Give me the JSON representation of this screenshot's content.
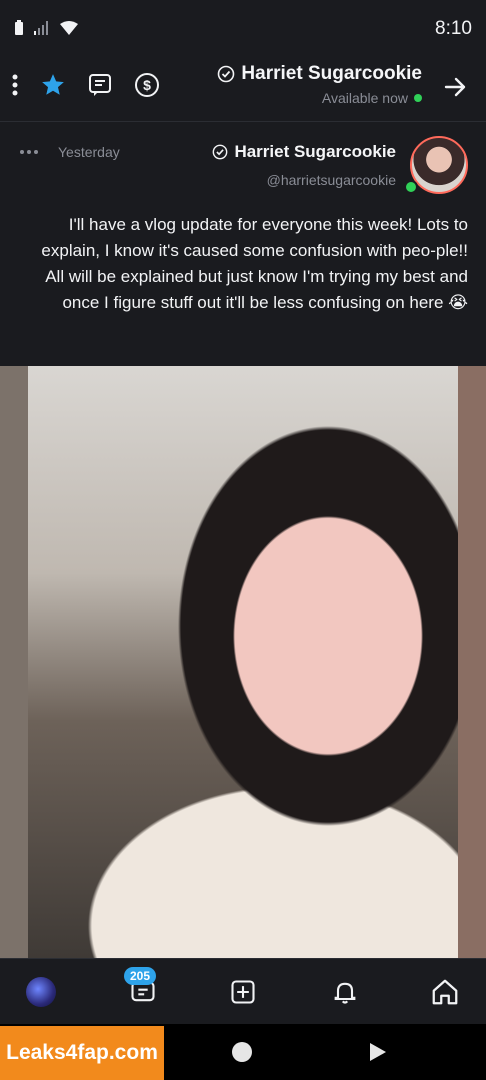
{
  "status_bar": {
    "time": "8:10"
  },
  "header": {
    "title": "Harriet Sugarcookie",
    "status": "Available now",
    "icons": [
      "back-arrow-icon",
      "verified-icon",
      "tip-dollar-icon",
      "chat-icon",
      "star-icon",
      "more-vertical-icon"
    ]
  },
  "post": {
    "author_name": "Harriet Sugarcookie",
    "author_handle": "@harrietsugarcookie",
    "timestamp": "Yesterday",
    "text": "I'll have a vlog update for everyone this week! Lots to explain, I know it's caused some confusion with peo-ple!! All will be explained but just know I'm trying my best and once I figure stuff out it'll be less confusing on here 😭"
  },
  "bottom_nav": {
    "items": [
      "home-icon",
      "notifications-icon",
      "add-post-icon",
      "messages-icon",
      "profile-avatar"
    ],
    "messages_badge": "205"
  },
  "watermark": "Leaks4fap.com",
  "colors": {
    "accent": "#2ea3ea",
    "online": "#30d158",
    "background": "#1a1b1f",
    "watermark": "#f28a1c"
  }
}
